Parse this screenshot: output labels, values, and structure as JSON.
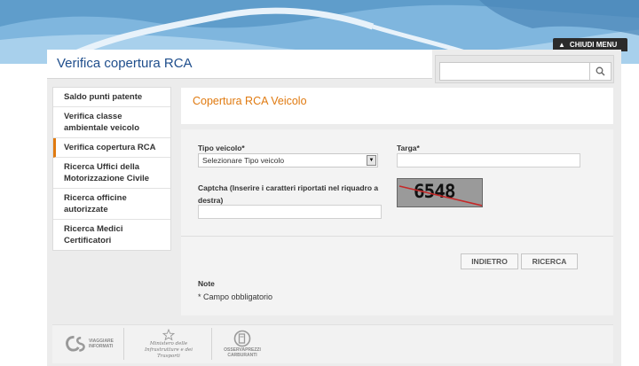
{
  "header": {
    "menu_button_label": "CHIUDI MENU",
    "menu_button_icon": "chevron-up-icon"
  },
  "page": {
    "title": "Verifica copertura RCA",
    "search_icon": "search-icon"
  },
  "sidebar": {
    "items": [
      {
        "label": "Saldo punti patente"
      },
      {
        "label": "Verifica classe ambientale veicolo"
      },
      {
        "label": "Verifica copertura RCA"
      },
      {
        "label": "Ricerca Uffici della Motorizzazione Civile"
      },
      {
        "label": "Ricerca officine autorizzate"
      },
      {
        "label": "Ricerca Medici Certificatori"
      }
    ]
  },
  "form": {
    "title": "Copertura RCA Veicolo",
    "vehicle_type_label": "Tipo veicolo*",
    "vehicle_type_value": "Selezionare Tipo veicolo",
    "plate_label": "Targa*",
    "plate_value": "",
    "captcha_label": "Captcha (Inserire i caratteri riportati nel riquadro a destra)",
    "captcha_value": "",
    "captcha_image_text": "6548",
    "back_button": "INDIETRO",
    "search_button": "RICERCA"
  },
  "notes": {
    "title": "Note",
    "text": "* Campo obbligatorio"
  },
  "footer": {
    "logo1_text_a": "VIAGGIARE",
    "logo1_text_b": "INFORMATI",
    "logo2_text_a": "Ministero delle",
    "logo2_text_b": "Infrastrutture e dei Trasporti",
    "logo3_text_a": "OSSERVAPREZZI",
    "logo3_text_b": "CARBURANTI"
  },
  "colors": {
    "accent": "#e07a10",
    "title": "#1f4e8c"
  }
}
